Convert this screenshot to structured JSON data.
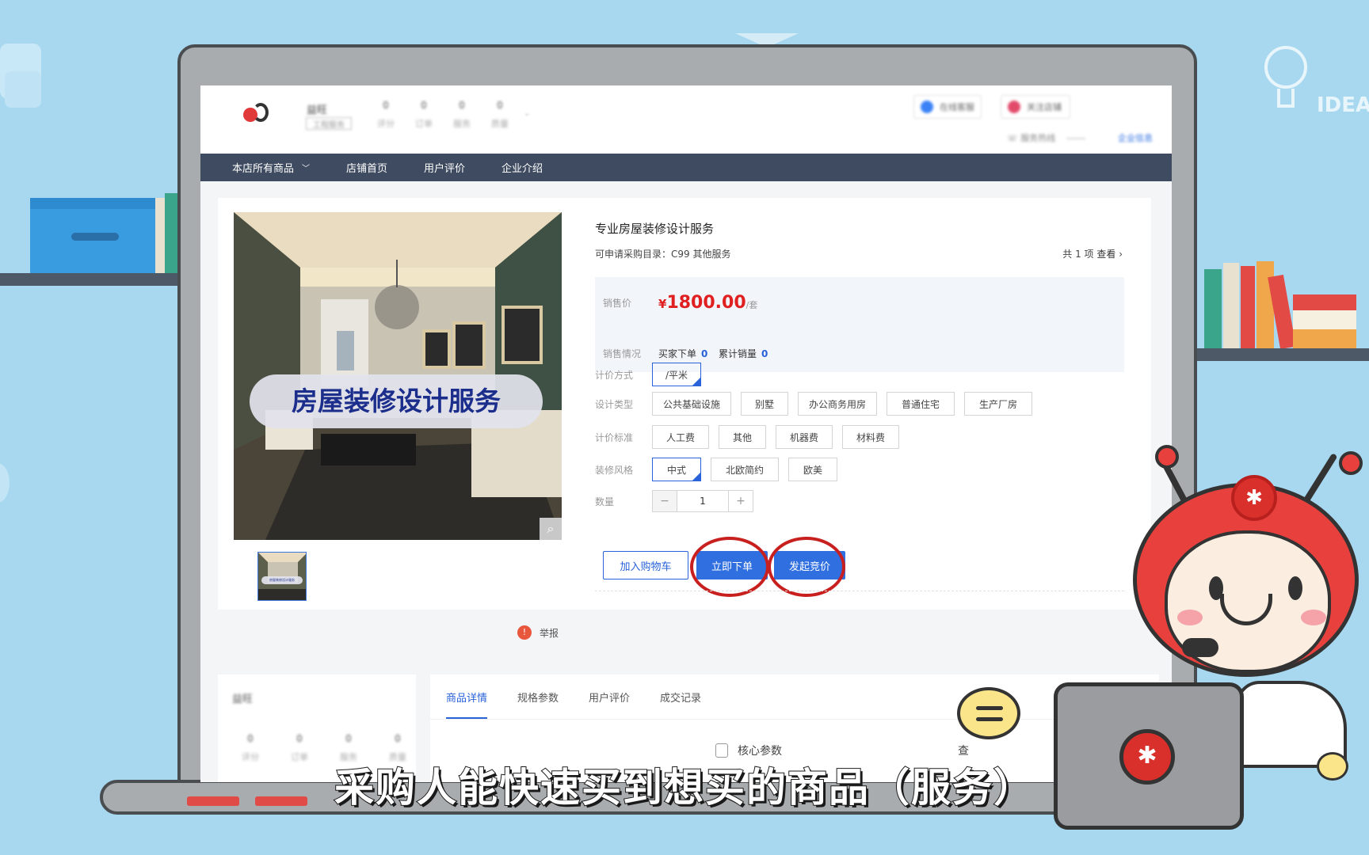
{
  "header": {
    "shop_name": "益旺",
    "shop_tag": "工程服务",
    "stats": [
      {
        "num": "0",
        "label": "评分"
      },
      {
        "num": "0",
        "label": "订单"
      },
      {
        "num": "0",
        "label": "服务"
      },
      {
        "num": "0",
        "label": "质量"
      }
    ],
    "btn_online": "在线客服",
    "btn_follow": "关注店铺",
    "phone_label": "服务热线",
    "phone_value": "------",
    "link": "企业信息"
  },
  "nav": {
    "items": [
      "本店所有商品",
      "店铺首页",
      "用户评价",
      "企业介绍"
    ]
  },
  "product": {
    "image_banner": "房屋装修设计服务",
    "title": "专业房屋装修设计服务",
    "catalog_label": "可申请采购目录：C99 其他服务",
    "total_text": "共 1 项",
    "view_text": "查看",
    "price_label": "销售价",
    "currency": "¥",
    "price": "1800.00",
    "price_unit": "/套",
    "sales_label": "销售情况",
    "buyer_orders_label": "买家下单",
    "buyer_orders_value": "0",
    "total_sales_label": "累计销量",
    "total_sales_value": "0",
    "pricing_method_label": "计价方式",
    "pricing_method_options": [
      "/平米"
    ],
    "design_type_label": "设计类型",
    "design_type_options": [
      "公共基础设施",
      "别墅",
      "办公商务用房",
      "普通住宅",
      "生产厂房"
    ],
    "pricing_standard_label": "计价标准",
    "pricing_standard_options": [
      "人工费",
      "其他",
      "机器费",
      "材料费"
    ],
    "style_label": "装修风格",
    "style_options": [
      "中式",
      "北欧简约",
      "欧美"
    ],
    "qty_label": "数量",
    "qty_minus": "−",
    "qty_value": "1",
    "qty_plus": "+",
    "btn_cart": "加入购物车",
    "btn_buy": "立即下单",
    "btn_bid": "发起竞价",
    "report": "举报",
    "thumb_banner": "房屋装修设计服务"
  },
  "lower": {
    "shop_name": "益旺",
    "stats": [
      {
        "num": "0",
        "label": "评分"
      },
      {
        "num": "0",
        "label": "订单"
      },
      {
        "num": "0",
        "label": "服务"
      },
      {
        "num": "0",
        "label": "质量"
      }
    ],
    "tabs": [
      "商品详情",
      "规格参数",
      "用户评价",
      "成交记录"
    ],
    "core_params": "核心参数",
    "core_right": "查"
  },
  "overlay": {
    "idea": "IDEA",
    "subtitle": "采购人能快速买到想买的商品（服务）"
  },
  "colors": {
    "accent_blue": "#2f6fe0",
    "price_red": "#e02020",
    "nav_bg": "#3e4b60",
    "highlight_circle": "#c8201f"
  }
}
